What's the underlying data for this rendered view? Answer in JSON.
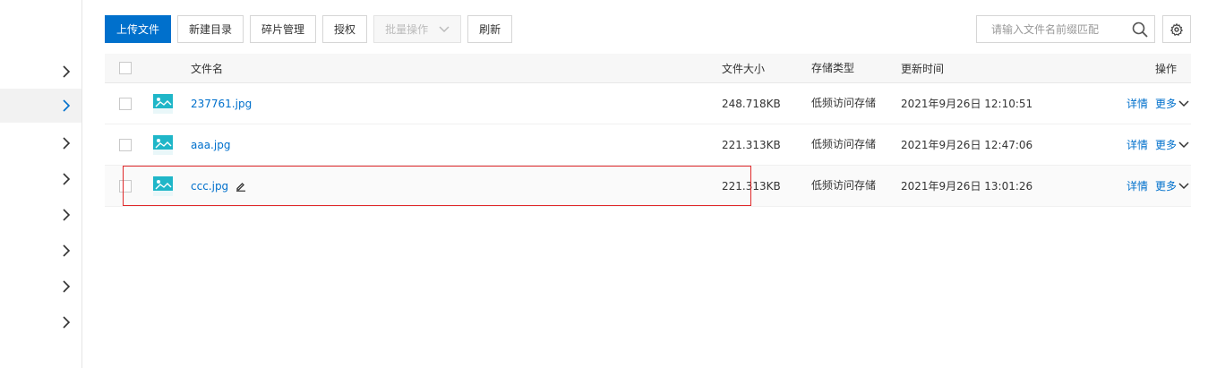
{
  "toolbar": {
    "upload": "上传文件",
    "new_dir": "新建目录",
    "fragments": "碎片管理",
    "authorize": "授权",
    "batch": "批量操作",
    "refresh": "刷新"
  },
  "search": {
    "placeholder": "请输入文件名前缀匹配",
    "icon": "search-icon"
  },
  "settings": {
    "icon": "gear-icon"
  },
  "sidebar": {
    "items": [
      {
        "icon": "chevron-right-icon",
        "active": false
      },
      {
        "icon": "chevron-right-icon",
        "active": true
      },
      {
        "icon": "chevron-right-icon",
        "active": false
      },
      {
        "icon": "chevron-right-icon",
        "active": false
      },
      {
        "icon": "chevron-right-icon",
        "active": false
      },
      {
        "icon": "chevron-right-icon",
        "active": false
      },
      {
        "icon": "chevron-right-icon",
        "active": false
      },
      {
        "icon": "chevron-right-icon",
        "active": false
      }
    ]
  },
  "table": {
    "headers": {
      "name": "文件名",
      "size": "文件大小",
      "storage": "存储类型",
      "updated": "更新时间",
      "ops": "操作"
    },
    "rows": [
      {
        "name": "237761.jpg",
        "size": "248.718KB",
        "storage": "低频访问存储",
        "updated": "2021年9月26日 12:10:51",
        "detail": "详情",
        "more": "更多"
      },
      {
        "name": "aaa.jpg",
        "size": "221.313KB",
        "storage": "低频访问存储",
        "updated": "2021年9月26日 12:47:06",
        "detail": "详情",
        "more": "更多"
      },
      {
        "name": "ccc.jpg",
        "size": "221.313KB",
        "storage": "低频访问存储",
        "updated": "2021年9月26日 13:01:26",
        "detail": "详情",
        "more": "更多"
      }
    ]
  },
  "colors": {
    "primary": "#0070cc",
    "highlight_border": "#e0292b",
    "file_icon": "#1fb6c8"
  }
}
